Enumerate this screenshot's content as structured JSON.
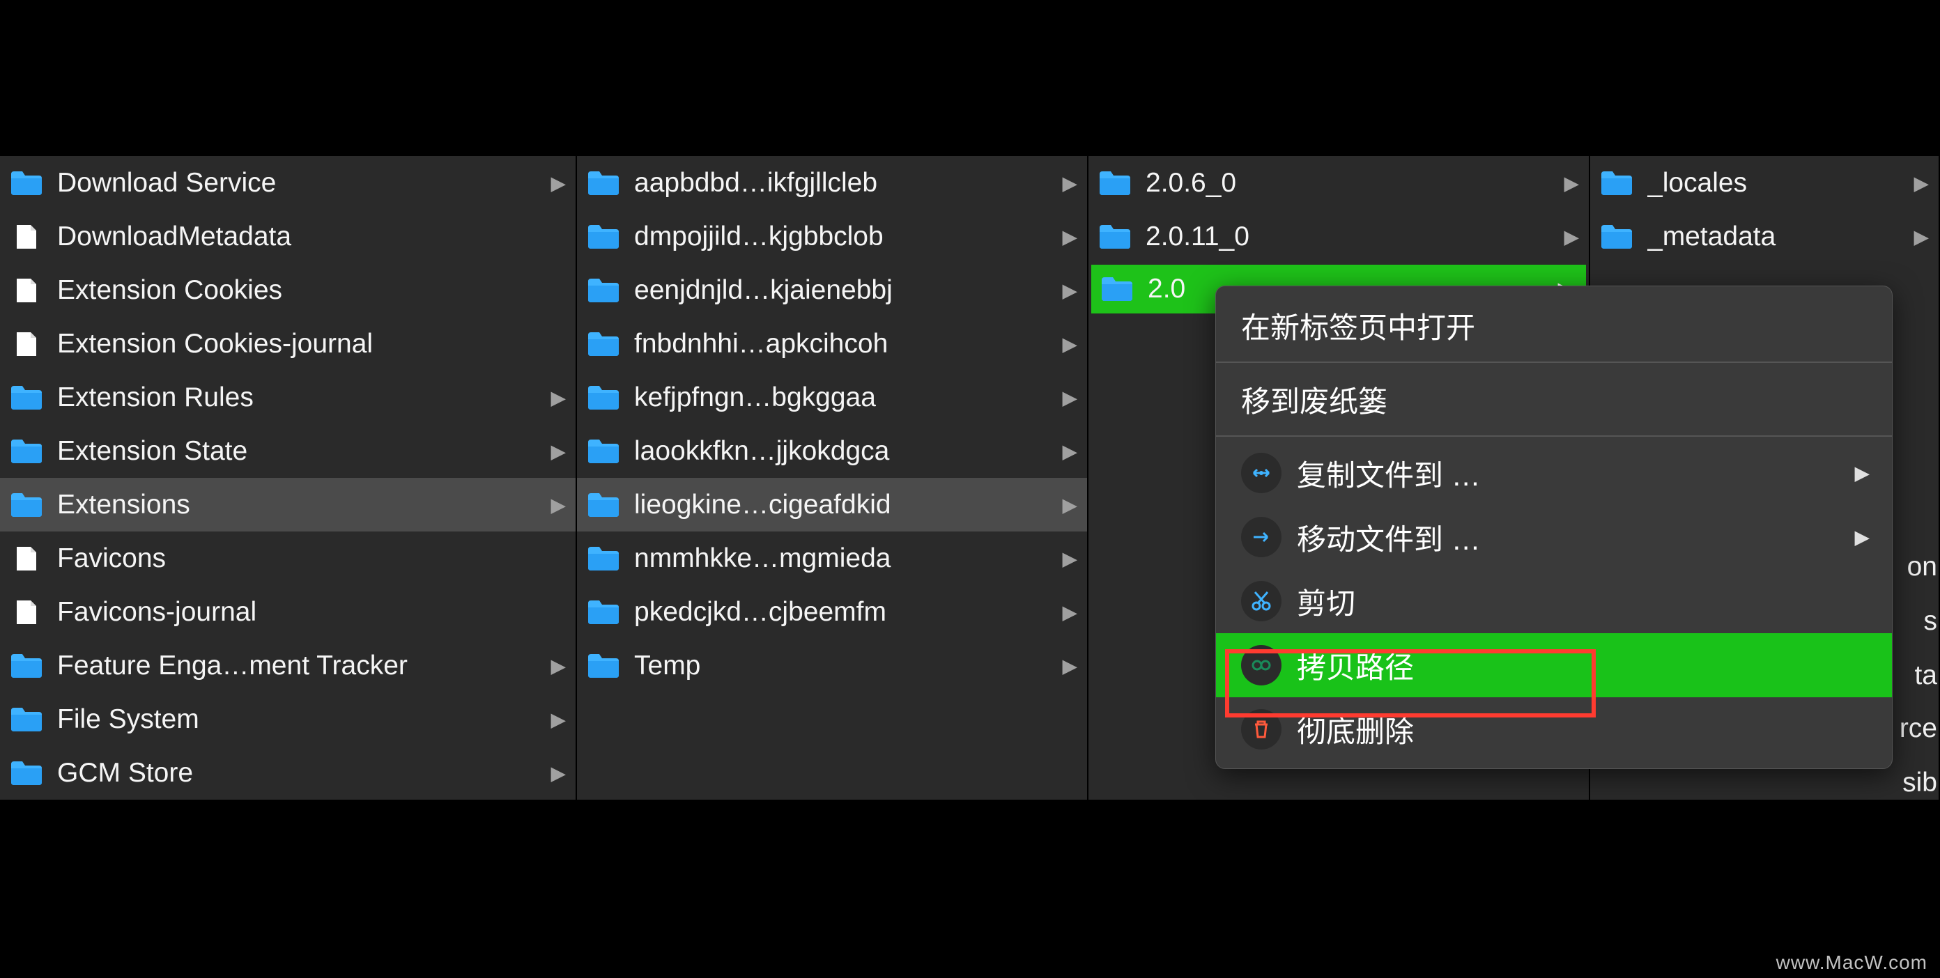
{
  "columns": [
    {
      "items": [
        {
          "type": "folder",
          "label": "Download Service",
          "hasChildren": true
        },
        {
          "type": "file",
          "label": "DownloadMetadata"
        },
        {
          "type": "file",
          "label": "Extension Cookies"
        },
        {
          "type": "file",
          "label": "Extension Cookies-journal"
        },
        {
          "type": "folder",
          "label": "Extension Rules",
          "hasChildren": true
        },
        {
          "type": "folder",
          "label": "Extension State",
          "hasChildren": true
        },
        {
          "type": "folder",
          "label": "Extensions",
          "hasChildren": true,
          "selected": true
        },
        {
          "type": "file",
          "label": "Favicons"
        },
        {
          "type": "file",
          "label": "Favicons-journal"
        },
        {
          "type": "folder",
          "label": "Feature Enga…ment Tracker",
          "hasChildren": true
        },
        {
          "type": "folder",
          "label": "File System",
          "hasChildren": true
        },
        {
          "type": "folder",
          "label": "GCM Store",
          "hasChildren": true
        }
      ]
    },
    {
      "items": [
        {
          "type": "folder",
          "label": "aapbdbd…ikfgjllcleb",
          "hasChildren": true
        },
        {
          "type": "folder",
          "label": "dmpojjild…kjgbbclob",
          "hasChildren": true
        },
        {
          "type": "folder",
          "label": "eenjdnjld…kjaienebbj",
          "hasChildren": true
        },
        {
          "type": "folder",
          "label": "fnbdnhhi…apkcihcoh",
          "hasChildren": true
        },
        {
          "type": "folder",
          "label": "kefjpfngn…bgkggaa",
          "hasChildren": true
        },
        {
          "type": "folder",
          "label": "laookkfkn…jjkokdgca",
          "hasChildren": true
        },
        {
          "type": "folder",
          "label": "lieogkine…cigeafdkid",
          "hasChildren": true,
          "selected": true
        },
        {
          "type": "folder",
          "label": "nmmhkke…mgmieda",
          "hasChildren": true
        },
        {
          "type": "folder",
          "label": "pkedcjkd…cjbeemfm",
          "hasChildren": true
        },
        {
          "type": "folder",
          "label": "Temp",
          "hasChildren": true
        }
      ]
    },
    {
      "items": [
        {
          "type": "folder",
          "label": "2.0.6_0",
          "hasChildren": true
        },
        {
          "type": "folder",
          "label": "2.0.11_0",
          "hasChildren": true
        },
        {
          "type": "folder",
          "label": "2.0",
          "hasChildren": true,
          "greenSelected": true
        }
      ]
    },
    {
      "items": [
        {
          "type": "folder",
          "label": "_locales",
          "hasChildren": true
        },
        {
          "type": "folder",
          "label": "_metadata",
          "hasChildren": true
        }
      ]
    }
  ],
  "partialLabels": [
    "on",
    "s",
    "ta",
    "rce",
    "sib"
  ],
  "contextMenu": {
    "items": [
      {
        "label": "在新标签页中打开",
        "icon": null
      },
      {
        "separator": true
      },
      {
        "label": "移到废纸篓",
        "icon": null
      },
      {
        "separator": true
      },
      {
        "label": "复制文件到 …",
        "icon": "copy-to",
        "hasSubmenu": true
      },
      {
        "label": "移动文件到 …",
        "icon": "move-to",
        "hasSubmenu": true
      },
      {
        "label": "剪切",
        "icon": "cut"
      },
      {
        "label": "拷贝路径",
        "icon": "copy-path",
        "highlighted": true
      },
      {
        "label": "彻底删除",
        "icon": "delete"
      }
    ]
  },
  "watermark": "www.MacW.com"
}
